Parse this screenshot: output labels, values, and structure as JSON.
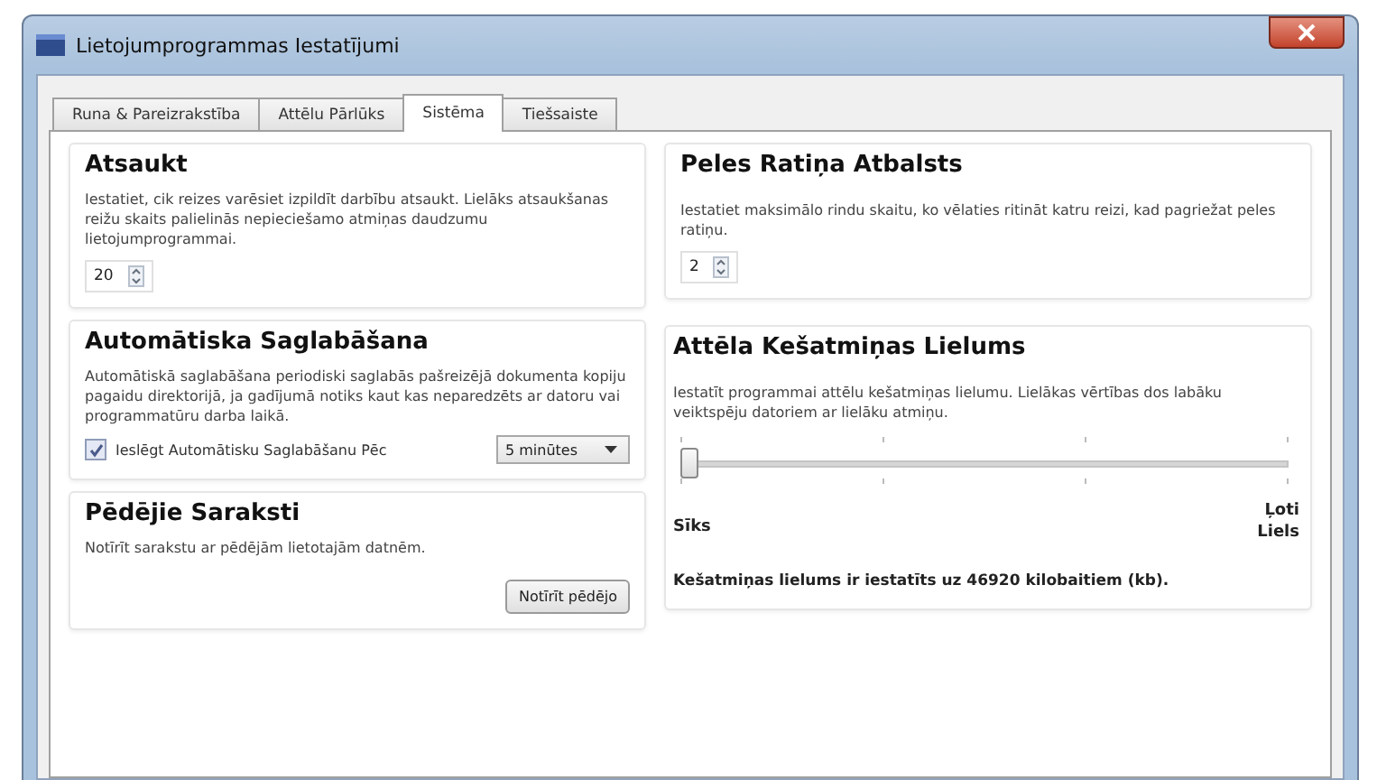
{
  "window": {
    "title": "Lietojumprogrammas Iestatījumi"
  },
  "tabs": [
    {
      "label": "Runa & Pareizrakstība",
      "selected": false
    },
    {
      "label": "Attēlu Pārlūks",
      "selected": false
    },
    {
      "label": "Sistēma",
      "selected": true
    },
    {
      "label": "Tiešsaiste",
      "selected": false
    }
  ],
  "left_groups": [
    {
      "kind": "spinner",
      "title": "Atsaukt",
      "description": "Iestatiet, cik reizes varēsiet izpildīt darbību atsaukt. Lielāks atsaukšanas reižu skaits palielinās nepieciešamo atmiņas daudzumu lietojumprogrammai.",
      "value": "20"
    },
    {
      "kind": "autosave",
      "title": "Automātiska Saglabāšana",
      "description": "Automātiskā saglabāšana periodiski saglabās pašreizējā dokumenta kopiju pagaidu direktorijā, ja gadījumā notiks kaut kas neparedzēts ar datoru vai programmatūru darba laikā.",
      "checkbox": {
        "label": "Ieslēgt Automātisku Saglabāšanu Pēc",
        "checked": true
      },
      "interval": "5 minūtes"
    },
    {
      "kind": "button",
      "title": "Pēdējie Saraksti",
      "description": "Notīrīt sarakstu ar pēdējām lietotajām datnēm.",
      "button": "Notīrīt pēdējo"
    }
  ],
  "right_groups": [
    {
      "kind": "spinner",
      "title": "Peles Ratiņa Atbalsts",
      "description": "Iestatiet maksimālo rindu skaitu, ko vēlaties ritināt katru reizi, kad pagriežat peles ratiņu.",
      "value": "2"
    },
    {
      "kind": "slider",
      "title": "Attēla Kešatmiņas Lielums",
      "description": "Iestatīt programmai attēlu kešatmiņas lielumu. Lielākas vērtības dos labāku veiktspēju datoriem ar lielāku atmiņu.",
      "level": 0,
      "min_label": "Sīks",
      "max_label": "Ļoti Liels",
      "status": "Kešatmiņas lielums ir iestatīts uz 46920 kilobaitiem (kb)."
    }
  ]
}
